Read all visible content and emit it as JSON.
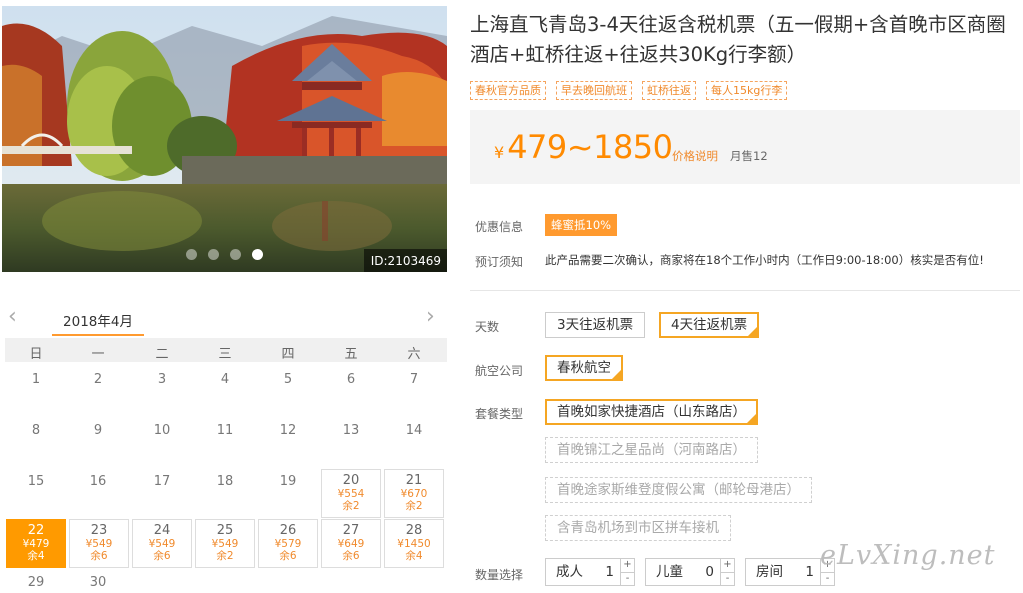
{
  "photo": {
    "id_label": "ID:2103469",
    "slide_count": 4,
    "active_slide": 4
  },
  "product": {
    "title": "上海直飞青岛3-4天往返含税机票（五一假期+含首晚市区商圈酒店+虹桥往返+往返共30Kg行李额）",
    "tags": [
      "春秋官方品质",
      "早去晚回航班",
      "虹桥往返",
      "每人15kg行李"
    ],
    "price_currency": "¥",
    "price_range": "479~1850",
    "price_note": "价格说明",
    "monthly_sales": "月售12"
  },
  "info": {
    "promo_label": "优惠信息",
    "promo_badge": "蜂蜜抵10%",
    "notice_label": "预订须知",
    "notice_text": "此产品需要二次确认，商家将在18个工作小时内（工作日9:00-18:00）核实是否有位!"
  },
  "options": {
    "days_label": "天数",
    "days": [
      {
        "label": "3天往返机票",
        "state": "normal"
      },
      {
        "label": "4天往返机票",
        "state": "selected"
      }
    ],
    "airline_label": "航空公司",
    "airline": [
      {
        "label": "春秋航空",
        "state": "selected"
      }
    ],
    "package_label": "套餐类型",
    "packages": [
      {
        "label": "首晚如家快捷酒店（山东路店）",
        "state": "selected"
      },
      {
        "label": "首晚锦江之星品尚（河南路店）",
        "state": "disabled"
      },
      {
        "label": "首晚途家斯维登度假公寓（邮轮母港店）",
        "state": "disabled"
      },
      {
        "label": "含青岛机场到市区拼车接机",
        "state": "disabled"
      }
    ],
    "quantity_label": "数量选择",
    "quantities": [
      {
        "label": "成人",
        "value": "1"
      },
      {
        "label": "儿童",
        "value": "0"
      },
      {
        "label": "房间",
        "value": "1"
      }
    ],
    "plus": "+",
    "minus": "-"
  },
  "calendar": {
    "prev_icon": "‹",
    "next_icon": "›",
    "month": "2018年4月",
    "weekdays": [
      "日",
      "一",
      "二",
      "三",
      "四",
      "五",
      "六"
    ],
    "plain_days": [
      "1",
      "2",
      "3",
      "4",
      "5",
      "6",
      "7",
      "8",
      "9",
      "10",
      "11",
      "12",
      "13",
      "14",
      "15",
      "16",
      "17",
      "18",
      "19",
      "29",
      "30"
    ],
    "priced_days": [
      {
        "day": "20",
        "price": "¥554",
        "stock": "余2"
      },
      {
        "day": "21",
        "price": "¥670",
        "stock": "余2"
      },
      {
        "day": "22",
        "price": "¥479",
        "stock": "余4",
        "selected": true
      },
      {
        "day": "23",
        "price": "¥549",
        "stock": "余6"
      },
      {
        "day": "24",
        "price": "¥549",
        "stock": "余6"
      },
      {
        "day": "25",
        "price": "¥549",
        "stock": "余2"
      },
      {
        "day": "26",
        "price": "¥579",
        "stock": "余6"
      },
      {
        "day": "27",
        "price": "¥649",
        "stock": "余6"
      },
      {
        "day": "28",
        "price": "¥1450",
        "stock": "余4"
      }
    ]
  },
  "watermark": "eLvXing.net",
  "colors": {
    "accent": "#ff9a00",
    "price": "#ff8a00",
    "tag": "#f08a2c"
  }
}
